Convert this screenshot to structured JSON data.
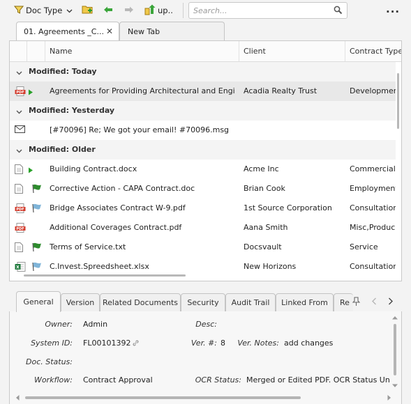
{
  "toolbar": {
    "doc_type_label": "Doc Type",
    "up_label": "up..",
    "search_placeholder": "Search...",
    "more_label": "..."
  },
  "doc_tabs": [
    {
      "label": "01. Agreements _C...",
      "close": "✕"
    },
    {
      "label": "New Tab"
    }
  ],
  "grid": {
    "columns": [
      "Name",
      "Client",
      "Contract Type"
    ],
    "groups": [
      {
        "label": "Modified: Today",
        "rows": [
          {
            "icon": "pdf",
            "flag": "arrow",
            "name": "Agreements for Providing Architectural and Engineeri...",
            "client": "Acadia Realty Trust",
            "type": "Developmen"
          }
        ]
      },
      {
        "label": "Modified: Yesterday",
        "rows": [
          {
            "icon": "mail",
            "flag": "",
            "name": "[#70096] Re; We got your email! #70096.msg",
            "client": "",
            "type": ""
          }
        ]
      },
      {
        "label": "Modified: Older",
        "rows": [
          {
            "icon": "doc",
            "flag": "arrow",
            "name": "Building Contract.docx",
            "client": "Acme Inc",
            "type": "Commercial"
          },
          {
            "icon": "doc",
            "flag": "green",
            "name": "Corrective Action - CAPA Contract.doc",
            "client": "Brian Cook",
            "type": "Employment"
          },
          {
            "icon": "pdf",
            "flag": "blue",
            "name": "Bridge Associates Contract W-9.pdf",
            "client": "1st Source Corporation",
            "type": "Consultatior"
          },
          {
            "icon": "pdf",
            "flag": "",
            "name": "Additional Coverages Contract.pdf",
            "client": "Aana Smith",
            "type": "Misc,Produc"
          },
          {
            "icon": "doc",
            "flag": "green",
            "name": "Terms of Service.txt",
            "client": "Docsvault",
            "type": "Service"
          },
          {
            "icon": "xls",
            "flag": "blue",
            "name": "C.Invest.Spreedsheet.xlsx",
            "client": "New Horizons",
            "type": "Consultatior"
          }
        ]
      }
    ]
  },
  "bottom_tabs": [
    "General",
    "Version",
    "Related Documents",
    "Security",
    "Audit Trail",
    "Linked From",
    "Re"
  ],
  "details": {
    "owner_label": "Owner:",
    "owner_value": "Admin",
    "desc_label": "Desc:",
    "desc_value": "",
    "system_id_label": "System ID:",
    "system_id_value": "FL00101392",
    "ver_label": "Ver. #:",
    "ver_value": "8",
    "ver_notes_label": "Ver. Notes:",
    "ver_notes_value": "add changes",
    "doc_status_label": "Doc. Status:",
    "doc_status_value": "",
    "workflow_label": "Workflow:",
    "workflow_value": "Contract Approval",
    "ocr_label": "OCR Status:",
    "ocr_value": "Merged or Edited PDF. OCR Status Unavail"
  },
  "colors": {
    "pdf": "#d33b2c",
    "excel": "#1f7a3d",
    "flag_green": "#2e8b2e",
    "flag_blue": "#7fb4d8",
    "arrow": "#28a028",
    "folder": "#8cc63f"
  }
}
